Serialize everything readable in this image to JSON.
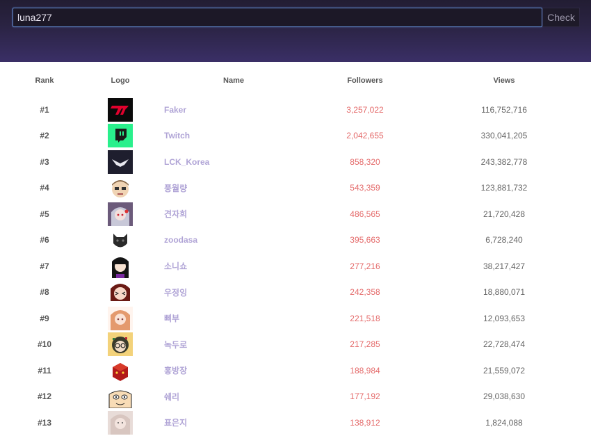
{
  "search": {
    "value": "luna277",
    "button_label": "Check"
  },
  "table": {
    "headers": {
      "rank": "Rank",
      "logo": "Logo",
      "name": "Name",
      "followers": "Followers",
      "views": "Views"
    },
    "rows": [
      {
        "rank": "#1",
        "name": "Faker",
        "followers": "3,257,022",
        "views": "116,752,716",
        "logo": "t1-logo-icon"
      },
      {
        "rank": "#2",
        "name": "Twitch",
        "followers": "2,042,655",
        "views": "330,041,205",
        "logo": "twitch-logo-icon"
      },
      {
        "rank": "#3",
        "name": "LCK_Korea",
        "followers": "858,320",
        "views": "243,382,778",
        "logo": "lck-logo-icon"
      },
      {
        "rank": "#4",
        "name": "풍월량",
        "followers": "543,359",
        "views": "123,881,732",
        "logo": "avatar-icon"
      },
      {
        "rank": "#5",
        "name": "견자희",
        "followers": "486,565",
        "views": "21,720,428",
        "logo": "avatar-icon"
      },
      {
        "rank": "#6",
        "name": "zoodasa",
        "followers": "395,663",
        "views": "6,728,240",
        "logo": "cat-avatar-icon"
      },
      {
        "rank": "#7",
        "name": "소니쇼",
        "followers": "277,216",
        "views": "38,217,427",
        "logo": "avatar-icon"
      },
      {
        "rank": "#8",
        "name": "우정잉",
        "followers": "242,358",
        "views": "18,880,071",
        "logo": "avatar-icon"
      },
      {
        "rank": "#9",
        "name": "삐부",
        "followers": "221,518",
        "views": "12,093,653",
        "logo": "avatar-icon"
      },
      {
        "rank": "#10",
        "name": "녹두로",
        "followers": "217,285",
        "views": "22,728,474",
        "logo": "avatar-icon"
      },
      {
        "rank": "#11",
        "name": "홍방장",
        "followers": "188,984",
        "views": "21,559,072",
        "logo": "avatar-icon"
      },
      {
        "rank": "#12",
        "name": "쉐리",
        "followers": "177,192",
        "views": "29,038,630",
        "logo": "avatar-icon"
      },
      {
        "rank": "#13",
        "name": "표은지",
        "followers": "138,912",
        "views": "1,824,088",
        "logo": "avatar-icon"
      }
    ]
  }
}
